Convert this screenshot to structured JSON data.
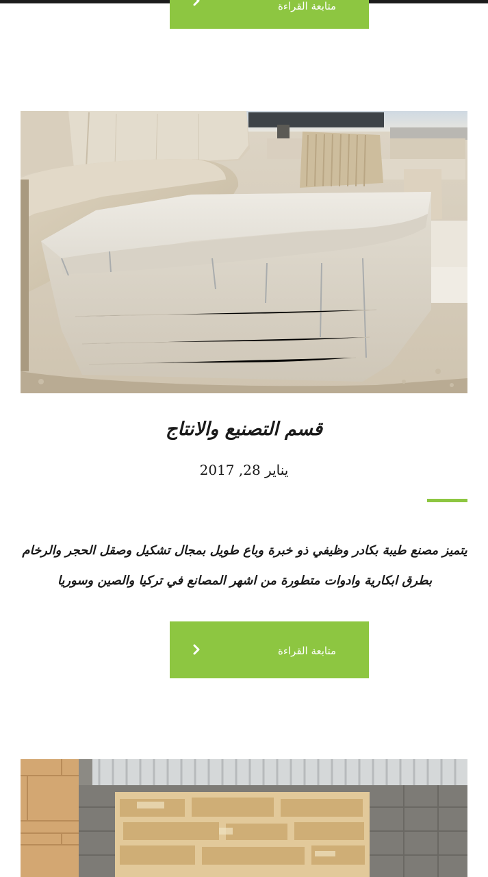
{
  "read_more_top": {
    "label": "متابعة القراءة"
  },
  "post": {
    "title": "قسم التصنيع والانتاج",
    "date": "يناير 28, 2017",
    "excerpt": "يتميز مصنع طيبة بكادر وظيفي ذو خبرة وباع طويل بمجال تشكيل وصقل الحجر والرخام بطرق ابكارية وادوات متطورة من اشهر المصانع في تركيا والصين وسوريا",
    "read_more": {
      "label": "متابعة القراءة"
    }
  },
  "icons": {
    "read_more": "chevron-right-icon"
  },
  "colors": {
    "accent": "#8dc641",
    "text": "#1a1a1a",
    "background": "#ffffff"
  }
}
